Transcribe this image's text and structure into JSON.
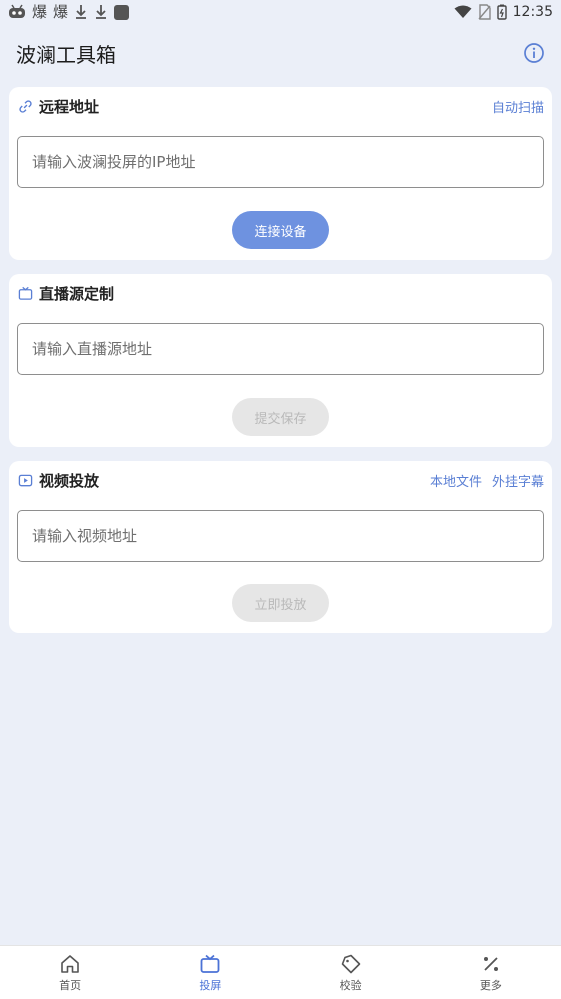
{
  "status_bar": {
    "left_icons": [
      "robot-icon",
      "burst-icon",
      "burst-icon",
      "download-icon",
      "download-icon",
      "app-square-icon"
    ],
    "glyph_bao": "爆",
    "time": "12:35"
  },
  "header": {
    "title": "波澜工具箱"
  },
  "remote": {
    "title": "远程地址",
    "action": "自动扫描",
    "placeholder": "请输入波澜投屏的IP地址",
    "button": "连接设备"
  },
  "live_source": {
    "title": "直播源定制",
    "placeholder": "请输入直播源地址",
    "button": "提交保存"
  },
  "video_cast": {
    "title": "视频投放",
    "actions": [
      "本地文件",
      "外挂字幕"
    ],
    "placeholder": "请输入视频地址",
    "button": "立即投放"
  },
  "bottom_nav": {
    "items": [
      {
        "label": "首页",
        "icon": "home-icon"
      },
      {
        "label": "投屏",
        "icon": "tv-icon"
      },
      {
        "label": "校验",
        "icon": "tag-icon"
      },
      {
        "label": "更多",
        "icon": "percent-icon"
      }
    ],
    "active_index": 1
  },
  "colors": {
    "background": "#ebeff8",
    "accent": "#5a7fd4",
    "primary_button": "#6e92e0",
    "disabled_button": "#e6e6e6"
  }
}
